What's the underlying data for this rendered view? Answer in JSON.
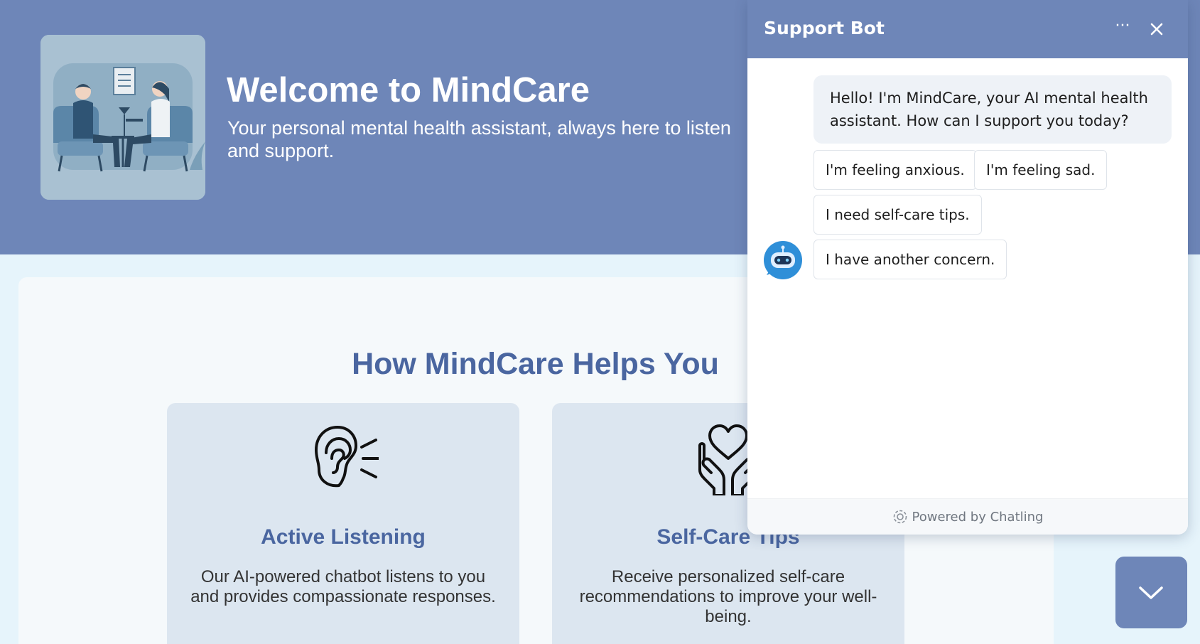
{
  "hero": {
    "title": "Welcome to MindCare",
    "subtitle": "Your personal mental health assistant, always here to listen and support."
  },
  "features": {
    "section_title": "How MindCare Helps You",
    "cards": [
      {
        "icon": "ear-listening-icon",
        "title": "Active Listening",
        "description": "Our AI-powered chatbot listens to you and provides compassionate responses."
      },
      {
        "icon": "hands-heart-icon",
        "title": "Self-Care Tips",
        "description": "Receive personalized self-care recommendations to improve your well-being."
      }
    ]
  },
  "chat": {
    "title": "Support Bot",
    "more_label": "···",
    "bot_message": "Hello! I'm MindCare, your AI mental health assistant. How can I support you today?",
    "quick_replies": [
      "I'm feeling anxious.",
      "I'm feeling sad.",
      "I need self-care tips.",
      "I have another concern."
    ],
    "footer": "Powered by Chatling"
  },
  "colors": {
    "brand": "#6e86b8",
    "heading": "#4a66a0",
    "page_bg": "#e6f4fb",
    "card_bg": "#dce6f0",
    "bot_avatar": "#2f8fd8"
  },
  "icons": {
    "chat_more": "more-horizontal-icon",
    "chat_close": "close-icon",
    "bot_avatar": "robot-avatar-icon",
    "footer_logo": "chatling-logo-icon",
    "toggle": "chevron-down-icon"
  }
}
